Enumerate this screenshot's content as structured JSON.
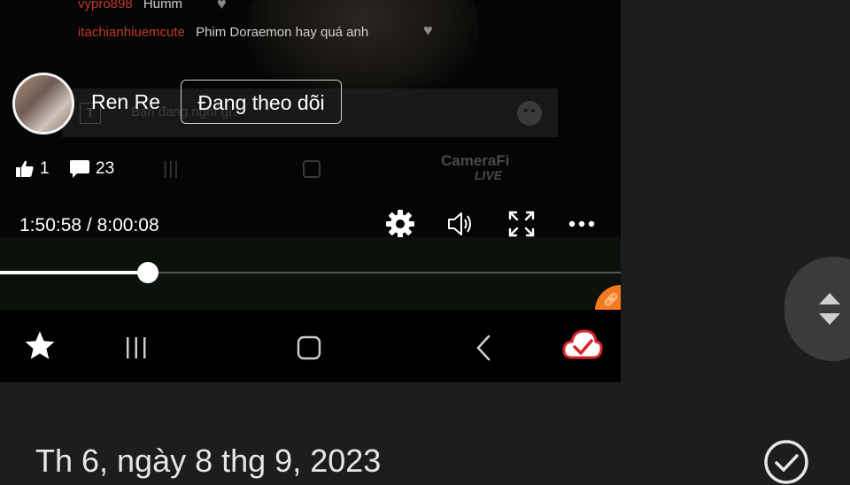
{
  "comments": [
    {
      "user": "vypro898",
      "text": "Humm"
    },
    {
      "user": "itachianhiuemcute",
      "text": "Phim Doraemon hay quá anh"
    }
  ],
  "chat": {
    "placeholder": "Bạn đang nghĩ gì?",
    "format_glyph": "T"
  },
  "streamer": {
    "name": "Ren Re",
    "follow_label": "Đang theo dõi"
  },
  "stats": {
    "likes": "1",
    "comments": "23"
  },
  "watermark": {
    "brand": "CameraFi",
    "sub": "LIVE"
  },
  "player": {
    "time_label": "1:50:58 / 8:00:08",
    "progress": 0.2377
  },
  "icons": {
    "like": "thumbs-up-icon",
    "comment": "comment-bubble-icon",
    "settings": "gear-icon",
    "volume": "speaker-icon",
    "fullscreen": "fullscreen-icon",
    "more": "more-horizontal-icon",
    "favorite": "star-icon",
    "recents": "recent-apps-icon",
    "home": "home-icon",
    "back": "back-chevron-icon",
    "cloud": "cloud-check-icon",
    "scroll": "up-down-arrows-icon",
    "check": "check-circle-icon"
  },
  "colors": {
    "accent_red": "#c0392b",
    "orange": "#f47a1f",
    "background": "#1d1d1f"
  },
  "footer": {
    "date": "Th 6, ngày 8 thg 9, 2023"
  }
}
